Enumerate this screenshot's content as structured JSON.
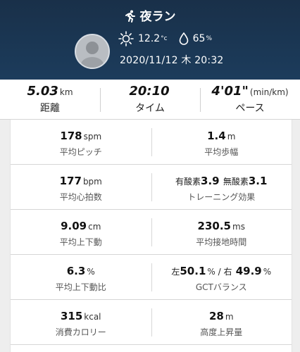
{
  "header": {
    "title": "夜ラン",
    "temperature": "12.2",
    "temperature_unit": "°c",
    "humidity": "65",
    "humidity_unit": "%",
    "datetime": "2020/11/12 木 20:32"
  },
  "summary": [
    {
      "value": "5.03",
      "unit": "km",
      "label": "距離"
    },
    {
      "value": "20:10",
      "unit": "",
      "label": "タイム"
    },
    {
      "value": "4'01\"",
      "unit": "(min/km)",
      "label": "ペース"
    }
  ],
  "stats": {
    "cadence": {
      "value": "178",
      "unit": "spm",
      "label": "平均ピッチ"
    },
    "stride": {
      "value": "1.4",
      "unit": "m",
      "label": "平均歩幅"
    },
    "heart_rate": {
      "value": "177",
      "unit": "bpm",
      "label": "平均心拍数"
    },
    "training_effect": {
      "aerobic_label": "有酸素",
      "aerobic_value": "3.9",
      "anaerobic_label": "無酸素",
      "anaerobic_value": "3.1",
      "label": "トレーニング効果"
    },
    "vertical_oscillation": {
      "value": "9.09",
      "unit": "cm",
      "label": "平均上下動"
    },
    "ground_contact_time": {
      "value": "230.5",
      "unit": "ms",
      "label": "平均接地時間"
    },
    "vertical_ratio": {
      "value": "6.3",
      "unit": "%",
      "label": "平均上下動比"
    },
    "gct_balance": {
      "left_label": "左",
      "left_value": "50.1",
      "left_unit": "%",
      "separator": " / ",
      "right_label": "右",
      "right_value": "49.9",
      "right_unit": "%",
      "label": "GCTバランス"
    },
    "calories": {
      "value": "315",
      "unit": "kcal",
      "label": "消費カロリー"
    },
    "elevation_gain": {
      "value": "28",
      "unit": "m",
      "label": "高度上昇量"
    }
  },
  "icons": {
    "runner": "runner-icon",
    "weather": "sun-icon",
    "humidity": "water-drop-icon",
    "avatar": "user-avatar"
  },
  "colors": {
    "header_bg": "#1c3c5c",
    "card_bg": "#ffffff",
    "page_bg": "#eeeeee"
  }
}
